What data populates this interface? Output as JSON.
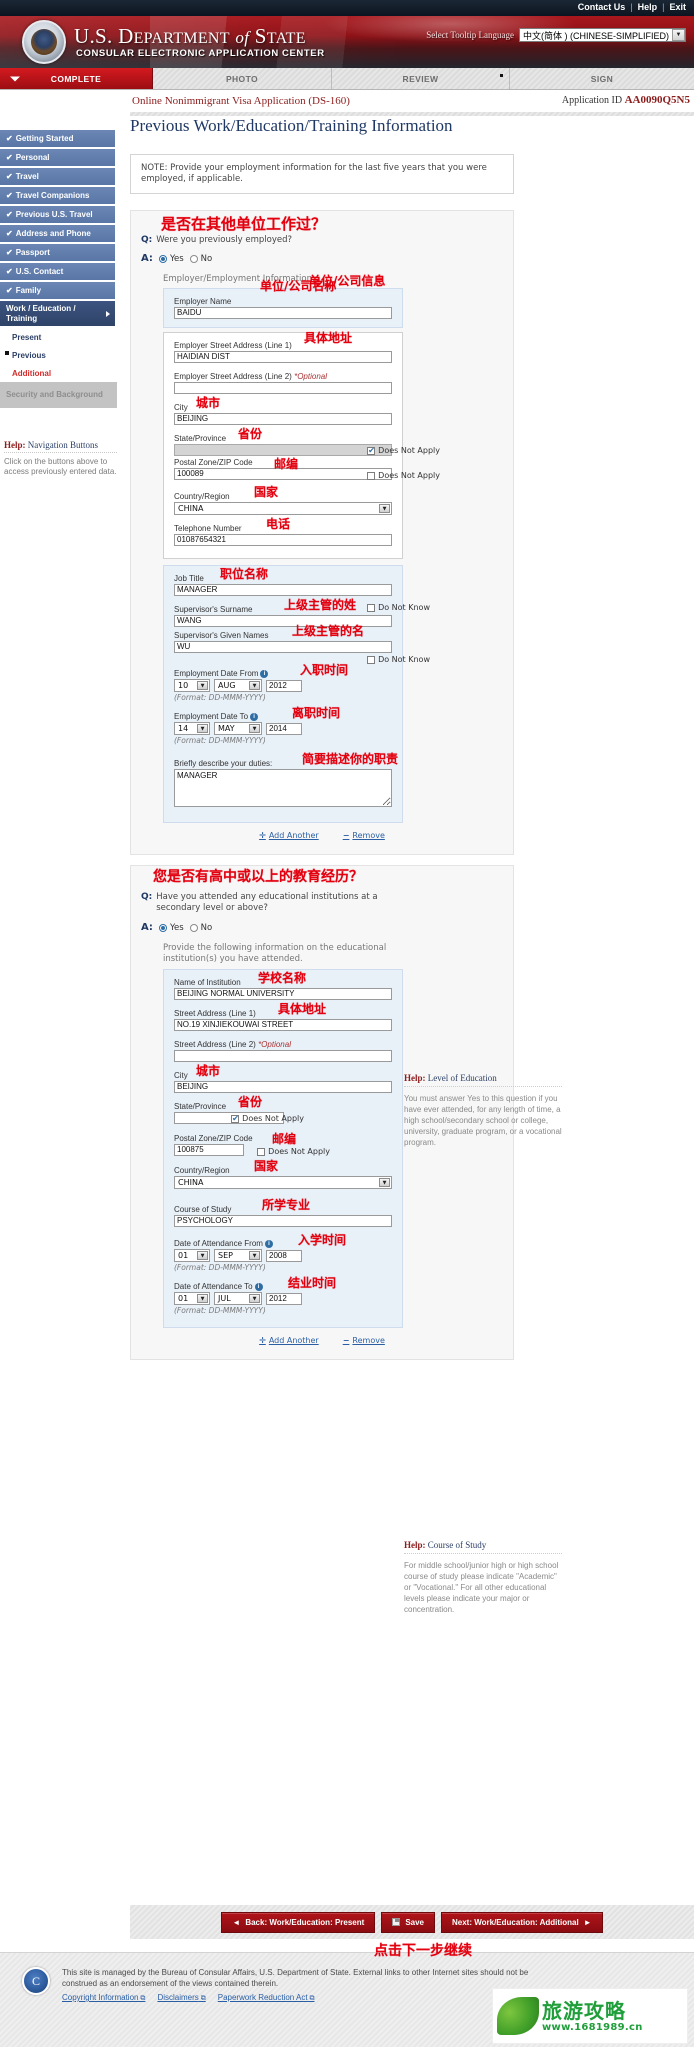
{
  "topbar": {
    "contact": "Contact Us",
    "help": "Help",
    "exit": "Exit"
  },
  "banner": {
    "title_us": "U.S. D",
    "title_epartment": "EPARTMENT",
    "title_of": "of",
    "title_s": "S",
    "title_tate": "TATE",
    "subtitle": "CONSULAR ELECTRONIC APPLICATION CENTER",
    "tooltip_label": "Select Tooltip Language",
    "tooltip_value": "中文(简体 ) (CHINESE-SIMPLIFIED)"
  },
  "proctabs": [
    {
      "label": "COMPLETE",
      "active": true
    },
    {
      "label": "PHOTO",
      "active": false
    },
    {
      "label": "REVIEW",
      "active": false
    },
    {
      "label": "SIGN",
      "active": false
    }
  ],
  "appheader": {
    "form_name": "Online Nonimmigrant Visa Application (DS-160)",
    "appid_label": "Application ID",
    "appid_value": "AA0090Q5N5"
  },
  "sidebar": {
    "items": [
      {
        "label": "Getting Started",
        "check": "✔"
      },
      {
        "label": "Personal",
        "check": "✔"
      },
      {
        "label": "Travel",
        "check": "✔"
      },
      {
        "label": "Travel Companions",
        "check": "✔"
      },
      {
        "label": "Previous U.S. Travel",
        "check": "✔"
      },
      {
        "label": "Address and Phone",
        "check": "✔"
      },
      {
        "label": "Passport",
        "check": "✔"
      },
      {
        "label": "U.S. Contact",
        "check": "✔"
      },
      {
        "label": "Family",
        "check": "✔"
      }
    ],
    "current": "Work / Education / Training",
    "subitems": [
      {
        "label": "Present",
        "state": "normal"
      },
      {
        "label": "Previous",
        "state": "selected"
      },
      {
        "label": "Additional",
        "state": "red"
      }
    ],
    "disabled": "Security and Background",
    "help_title_prefix": "Help:",
    "help_title": "Navigation Buttons",
    "help_body": "Click on the buttons above to access previously entered data."
  },
  "main": {
    "page_title": "Previous Work/Education/Training Information",
    "note": "NOTE: Provide your employment information for the last five years that you were employed, if applicable.",
    "work": {
      "q_label": "Q:",
      "question": "Were you previously employed?",
      "a_label": "A:",
      "yes": "Yes",
      "no": "No",
      "selected": "Yes",
      "section_label": "Employer/Employment Information:",
      "fields": {
        "employer_name_label": "Employer Name",
        "employer_name_value": "BAIDU",
        "addr1_label": "Employer Street Address (Line 1)",
        "addr1_value": "HAIDIAN DIST",
        "addr2_label": "Employer Street Address (Line 2)",
        "addr2_optional": "*Optional",
        "addr2_value": "",
        "city_label": "City",
        "city_value": "BEIJING",
        "state_label": "State/Province",
        "state_value": "",
        "state_dna": "Does Not Apply",
        "postal_label": "Postal Zone/ZIP Code",
        "postal_value": "100089",
        "postal_dna": "Does Not Apply",
        "country_label": "Country/Region",
        "country_value": "CHINA",
        "phone_label": "Telephone Number",
        "phone_value": "01087654321",
        "job_title_label": "Job Title",
        "job_title_value": "MANAGER",
        "sup_surname_label": "Supervisor's Surname",
        "sup_surname_value": "WANG",
        "sup_surname_dnk": "Do Not Know",
        "sup_given_label": "Supervisor's Given Names",
        "sup_given_value": "WU",
        "sup_given_dnk": "Do Not Know",
        "date_from_label": "Employment Date From",
        "date_from_day": "10",
        "date_from_month": "AUG",
        "date_from_year": "2012",
        "date_from_fmt": "(Format: DD-MMM-YYYY)",
        "date_to_label": "Employment Date To",
        "date_to_day": "14",
        "date_to_month": "MAY",
        "date_to_year": "2014",
        "date_to_fmt": "(Format: DD-MMM-YYYY)",
        "duties_label": "Briefly describe your duties:",
        "duties_value": "MANAGER"
      },
      "add_another": "Add Another",
      "remove": "Remove"
    },
    "education": {
      "q_label": "Q:",
      "question": "Have you attended any educational institutions at a secondary level or above?",
      "a_label": "A:",
      "yes": "Yes",
      "no": "No",
      "selected": "Yes",
      "section_label": "Provide the following information on the educational institution(s) you have attended.",
      "fields": {
        "institution_label": "Name of Institution",
        "institution_value": "BEIJING NORMAL UNIVERSITY",
        "addr1_label": "Street Address (Line 1)",
        "addr1_value": "NO.19 XINJIEKOUWAI STREET",
        "addr2_label": "Street Address (Line 2)",
        "addr2_optional": "*Optional",
        "addr2_value": "",
        "city_label": "City",
        "city_value": "BEIJING",
        "state_label": "State/Province",
        "state_value": "",
        "state_dna": "Does Not Apply",
        "postal_label": "Postal Zone/ZIP Code",
        "postal_value": "100875",
        "postal_dna": "Does Not Apply",
        "country_label": "Country/Region",
        "country_value": "CHINA",
        "course_label": "Course of Study",
        "course_value": "PSYCHOLOGY",
        "att_from_label": "Date of Attendance From",
        "att_from_day": "01",
        "att_from_month": "SEP",
        "att_from_year": "2008",
        "att_from_fmt": "(Format: DD-MMM-YYYY)",
        "att_to_label": "Date of Attendance To",
        "att_to_day": "01",
        "att_to_month": "JUL",
        "att_to_year": "2012",
        "att_to_fmt": "(Format: DD-MMM-YYYY)"
      },
      "add_another": "Add Another",
      "remove": "Remove"
    },
    "help_education": {
      "title_prefix": "Help:",
      "title": "Level of Education",
      "body": "You must answer Yes to this question if you have ever attended, for any length of time, a high school/secondary school or college, university, graduate program, or a vocational program."
    },
    "help_course": {
      "title_prefix": "Help:",
      "title": "Course of Study",
      "body": "For middle school/junior high or high school course of study please indicate \"Academic\" or \"Vocational.\" For all other educational levels please indicate your major or concentration."
    }
  },
  "annotations": {
    "work_q": "是否在其他单位工作过？",
    "employer_info": "单位/公司信息",
    "employer_name": "单位/公司名称",
    "addr": "具体地址",
    "city": "城市",
    "province": "省份",
    "postal": "邮编",
    "country": "国家",
    "phone": "电话",
    "job_title": "职位名称",
    "sup_surname": "上级主管的姓",
    "sup_given": "上级主管的名",
    "date_from": "入职时间",
    "date_to": "离职时间",
    "duties": "简要描述你的职责",
    "edu_q": "您是否有高中或以上的教育经历？",
    "school_name": "学校名称",
    "edu_addr": "具体地址",
    "edu_city": "城市",
    "edu_province": "省份",
    "edu_postal": "邮编",
    "edu_country": "国家",
    "major": "所学专业",
    "enroll": "入学时间",
    "graduate": "结业时间",
    "next_step": "点击下一步继续"
  },
  "buttons": {
    "back": "Back: Work/Education: Present",
    "save": "Save",
    "next": "Next: Work/Education: Additional"
  },
  "footer": {
    "text": "This site is managed by the Bureau of Consular Affairs, U.S. Department of State. External links to other Internet sites should not be construed as an endorsement of the views contained therein.",
    "links": [
      "Copyright Information",
      "Disclaimers",
      "Paperwork Reduction Act"
    ]
  },
  "watermark": {
    "text": "旅游攻略",
    "url": "www.1681989.cn"
  }
}
